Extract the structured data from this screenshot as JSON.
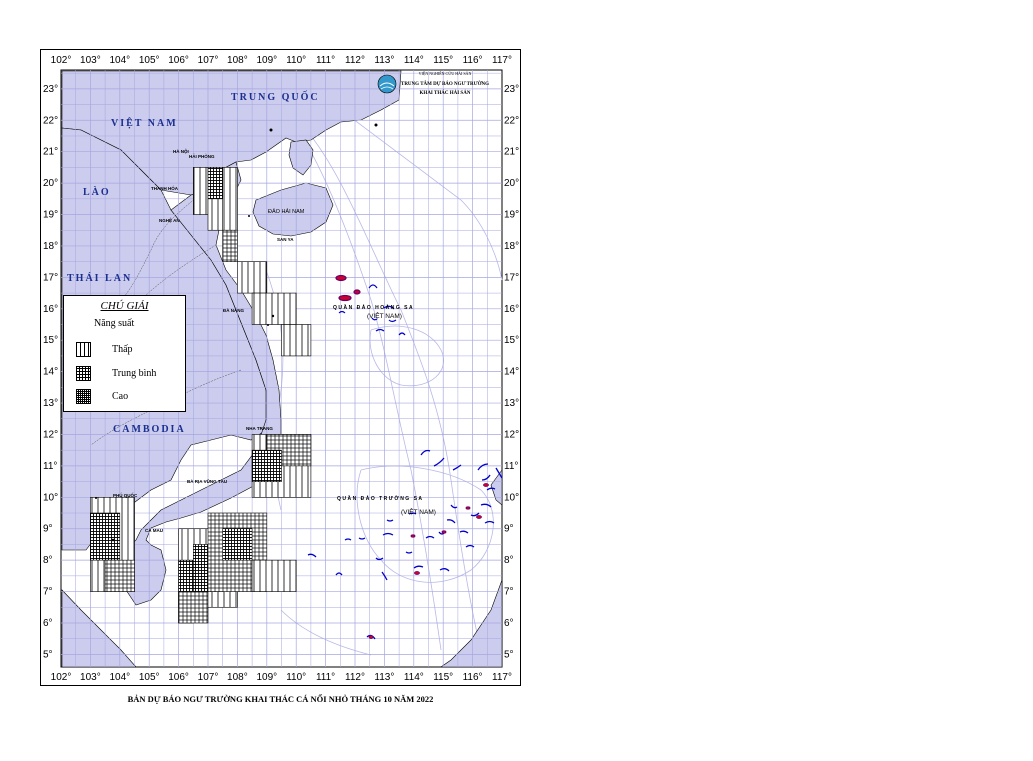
{
  "map": {
    "longitude_labels": [
      "102°",
      "103°",
      "104°",
      "105°",
      "106°",
      "107°",
      "108°",
      "109°",
      "110°",
      "111°",
      "112°",
      "113°",
      "114°",
      "115°",
      "116°",
      "117°"
    ],
    "latitude_labels": [
      "23°",
      "22°",
      "21°",
      "20°",
      "19°",
      "18°",
      "17°",
      "16°",
      "15°",
      "14°",
      "13°",
      "12°",
      "11°",
      "10°",
      "9°",
      "8°",
      "7°",
      "6°",
      "5°"
    ],
    "countries": {
      "china": "TRUNG QUỐC",
      "vietnam": "VIỆT NAM",
      "laos": "LÀO",
      "thailand": "THÁI LAN",
      "cambodia": "CAMBODIA"
    },
    "cities": {
      "hanoi": "HÀ NỘI",
      "haiphong": "HẢI PHÒNG",
      "thanhhoa": "THANH HÓA",
      "nghean": "NGHỆ AN",
      "danang": "ĐÀ NẴNG",
      "nhatrang": "NHA TRANG",
      "bariavungtau": "BÀ RỊA VŨNG TÀU",
      "phuquoc": "PHÚ QUỐC",
      "camau": "CÀ MAU",
      "sanya": "SAN YA"
    },
    "islands": {
      "hainan": "ĐẢO HẢI NAM",
      "hoangsa": "QUẦN ĐẢO HOÀNG SA",
      "hoangsa_sub": "(VIỆT NAM)",
      "truongsa": "QUẦN ĐẢO TRƯỜNG SA",
      "truongsa_sub": "(VIỆT NAM)"
    },
    "organization": {
      "line1": "VIỆN NGHIÊN CỨU HẢI SẢN",
      "line2": "TRUNG TÂM DỰ BÁO NGƯ TRƯỜNG",
      "line3": "KHAI THÁC HẢI SẢN"
    },
    "colors": {
      "land": "#ccccee",
      "sea": "#ffffff",
      "grid": "#a6a6e0",
      "coast": "#000000",
      "reef_blue": "#0000cc",
      "reef_red": "#cc0033"
    }
  },
  "legend": {
    "title": "CHÚ GIẢI",
    "subtitle": "Năng suất",
    "items": [
      {
        "label": "Thấp",
        "level": "low"
      },
      {
        "label": "Trung bình",
        "level": "medium"
      },
      {
        "label": "Cao",
        "level": "high"
      }
    ]
  },
  "caption": "BẢN DỰ BÁO NGƯ TRƯỜNG KHAI THÁC CÁ NỔI NHỎ THÁNG 10 NĂM 2022"
}
